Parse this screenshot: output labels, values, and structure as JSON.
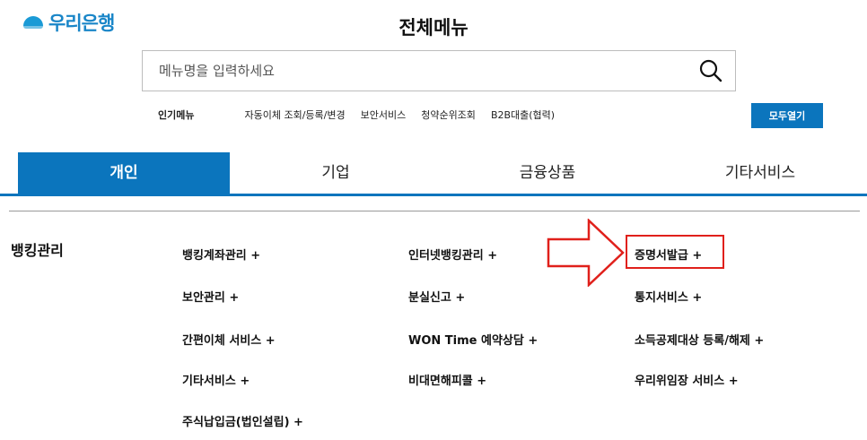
{
  "header": {
    "logo_text": "우리은행",
    "page_title": "전체메뉴"
  },
  "search": {
    "placeholder": "메뉴명을 입력하세요"
  },
  "popular": {
    "label": "인기메뉴",
    "links": [
      "자동이체 조회/등록/변경",
      "보안서비스",
      "청약순위조회",
      "B2B대출(협력)"
    ]
  },
  "open_all_label": "모두열기",
  "tabs": [
    {
      "label": "개인",
      "active": true
    },
    {
      "label": "기업",
      "active": false
    },
    {
      "label": "금융상품",
      "active": false
    },
    {
      "label": "기타서비스",
      "active": false
    }
  ],
  "category": {
    "title": "뱅킹관리",
    "items": [
      "뱅킹계좌관리 +",
      "인터넷뱅킹관리 +",
      "증명서발급 +",
      "보안관리 +",
      "분실신고 +",
      "통지서비스 +",
      "간편이체 서비스 +",
      "WON Time 예약상담 +",
      "소득공제대상 등록/해제 +",
      "기타서비스 +",
      "비대면해피콜 +",
      "우리위임장 서비스 +",
      "주식납입금(법인설립) +"
    ]
  },
  "colors": {
    "brand_blue": "#0b75bd",
    "logo_blue": "#1a86c8",
    "highlight_red": "#e0201b"
  }
}
